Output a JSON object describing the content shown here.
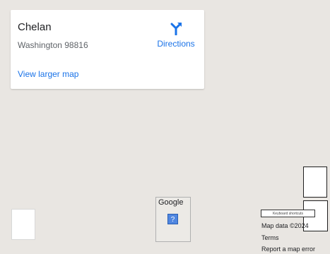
{
  "place": {
    "name": "Chelan",
    "address": "Washington 98816",
    "larger_map_label": "View larger map",
    "directions_label": "Directions",
    "directions_icon": "directions-icon"
  },
  "map": {
    "background_color": "#e9e6e2",
    "logo_text": "Google",
    "pegman_icon": "pegman-icon",
    "pegman_symbol": "?"
  },
  "footer": {
    "keyboard_shortcuts": "Keyboard shortcuts",
    "map_data": "Map data ©2024",
    "terms": "Terms",
    "report_error": "Report a map error"
  },
  "colors": {
    "link": "#1a73e8"
  }
}
